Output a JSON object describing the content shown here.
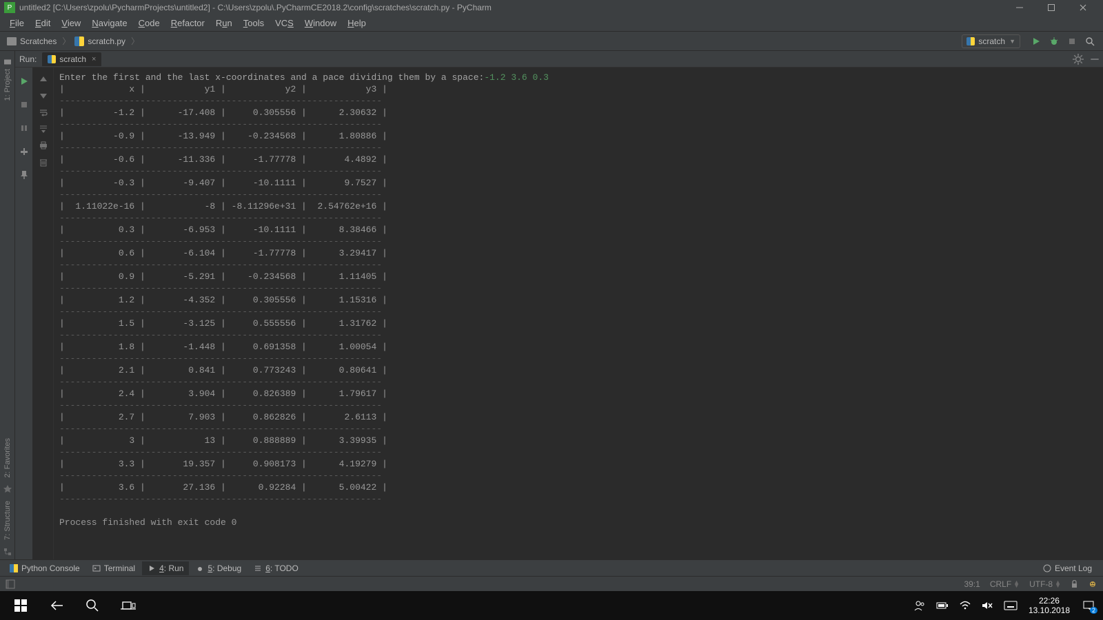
{
  "window": {
    "title": "untitled2 [C:\\Users\\zpolu\\PycharmProjects\\untitled2] - C:\\Users\\zpolu\\.PyCharmCE2018.2\\config\\scratches\\scratch.py - PyCharm"
  },
  "menu": [
    "File",
    "Edit",
    "View",
    "Navigate",
    "Code",
    "Refactor",
    "Run",
    "Tools",
    "VCS",
    "Window",
    "Help"
  ],
  "breadcrumb": {
    "item0": "Scratches",
    "item1": "scratch.py"
  },
  "run_config": {
    "name": "scratch"
  },
  "run_panel": {
    "label": "Run:",
    "tab": "scratch"
  },
  "console": {
    "prompt": "Enter the first and the last x-coordinates and a pace dividing them by a space:",
    "input": "-1.2 3.6 0.3",
    "headers": [
      "x",
      "y1",
      "y2",
      "y3"
    ],
    "rows": [
      {
        "x": "-1.2",
        "y1": "-17.408",
        "y2": "0.305556",
        "y3": "2.30632"
      },
      {
        "x": "-0.9",
        "y1": "-13.949",
        "y2": "-0.234568",
        "y3": "1.80886"
      },
      {
        "x": "-0.6",
        "y1": "-11.336",
        "y2": "-1.77778",
        "y3": "4.4892"
      },
      {
        "x": "-0.3",
        "y1": "-9.407",
        "y2": "-10.1111",
        "y3": "9.7527"
      },
      {
        "x": "1.11022e-16",
        "y1": "-8",
        "y2": "-8.11296e+31",
        "y3": "2.54762e+16"
      },
      {
        "x": "0.3",
        "y1": "-6.953",
        "y2": "-10.1111",
        "y3": "8.38466"
      },
      {
        "x": "0.6",
        "y1": "-6.104",
        "y2": "-1.77778",
        "y3": "3.29417"
      },
      {
        "x": "0.9",
        "y1": "-5.291",
        "y2": "-0.234568",
        "y3": "1.11405"
      },
      {
        "x": "1.2",
        "y1": "-4.352",
        "y2": "0.305556",
        "y3": "1.15316"
      },
      {
        "x": "1.5",
        "y1": "-3.125",
        "y2": "0.555556",
        "y3": "1.31762"
      },
      {
        "x": "1.8",
        "y1": "-1.448",
        "y2": "0.691358",
        "y3": "1.00054"
      },
      {
        "x": "2.1",
        "y1": "0.841",
        "y2": "0.773243",
        "y3": "0.80641"
      },
      {
        "x": "2.4",
        "y1": "3.904",
        "y2": "0.826389",
        "y3": "1.79617"
      },
      {
        "x": "2.7",
        "y1": "7.903",
        "y2": "0.862826",
        "y3": "2.6113"
      },
      {
        "x": "3",
        "y1": "13",
        "y2": "0.888889",
        "y3": "3.39935"
      },
      {
        "x": "3.3",
        "y1": "19.357",
        "y2": "0.908173",
        "y3": "4.19279"
      },
      {
        "x": "3.6",
        "y1": "27.136",
        "y2": "0.92284",
        "y3": "5.00422"
      }
    ],
    "exit": "Process finished with exit code 0"
  },
  "left_tools": {
    "project": "1: Project",
    "favorites": "2: Favorites",
    "structure": "7: Structure"
  },
  "bottom_tools": {
    "python_console": "Python Console",
    "terminal": "Terminal",
    "run": "4: Run",
    "debug": "5: Debug",
    "todo": "6: TODO",
    "event_log": "Event Log"
  },
  "status": {
    "pos": "39:1",
    "eol": "CRLF",
    "enc": "UTF-8"
  },
  "tray": {
    "time": "22:26",
    "date": "13.10.2018",
    "notif_count": "2"
  }
}
